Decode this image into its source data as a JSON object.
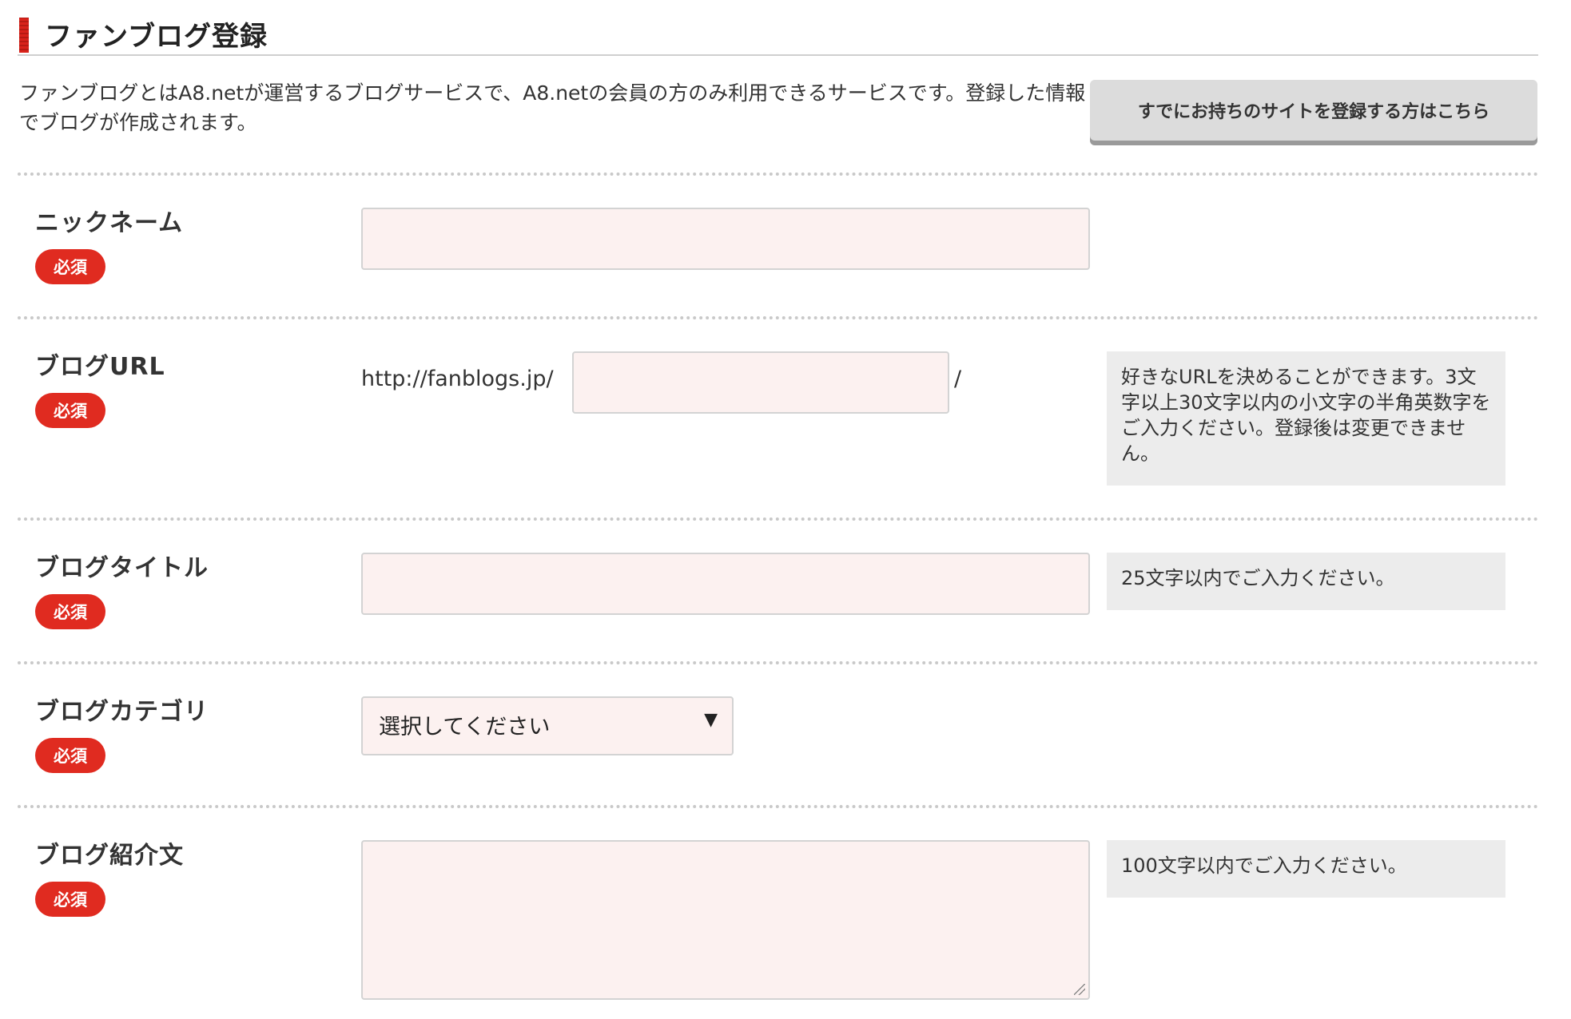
{
  "page": {
    "title": "ファンブログ登録",
    "intro": "ファンブログとはA8.netが運営するブログサービスで、A8.netの会員の方のみ利用できるサービスです。登録した情報でブログが作成されます。",
    "register_existing_button": "すでにお持ちのサイトを登録する方はこちら"
  },
  "fields": {
    "nickname": {
      "label": "ニックネーム",
      "badge": "必須",
      "value": ""
    },
    "blog_url": {
      "label": "ブログURL",
      "badge": "必須",
      "prefix": "http://fanblogs.jp/",
      "suffix": "/",
      "value": "",
      "help": "好きなURLを決めることができます。3文字以上30文字以内の小文字の半角英数字をご入力ください。登録後は変更できません。"
    },
    "blog_title": {
      "label": "ブログタイトル",
      "badge": "必須",
      "value": "",
      "help": "25文字以内でご入力ください。"
    },
    "blog_category": {
      "label": "ブログカテゴリ",
      "badge": "必須",
      "selected": "選択してください",
      "arrow": "▼"
    },
    "blog_description": {
      "label": "ブログ紹介文",
      "badge": "必須",
      "value": "",
      "help": "100文字以内でご入力ください。"
    }
  },
  "colors": {
    "accent_red": "#e02b20",
    "input_background": "#fcf1f0",
    "help_background": "#ececec",
    "button_background": "#dcdcdc"
  }
}
